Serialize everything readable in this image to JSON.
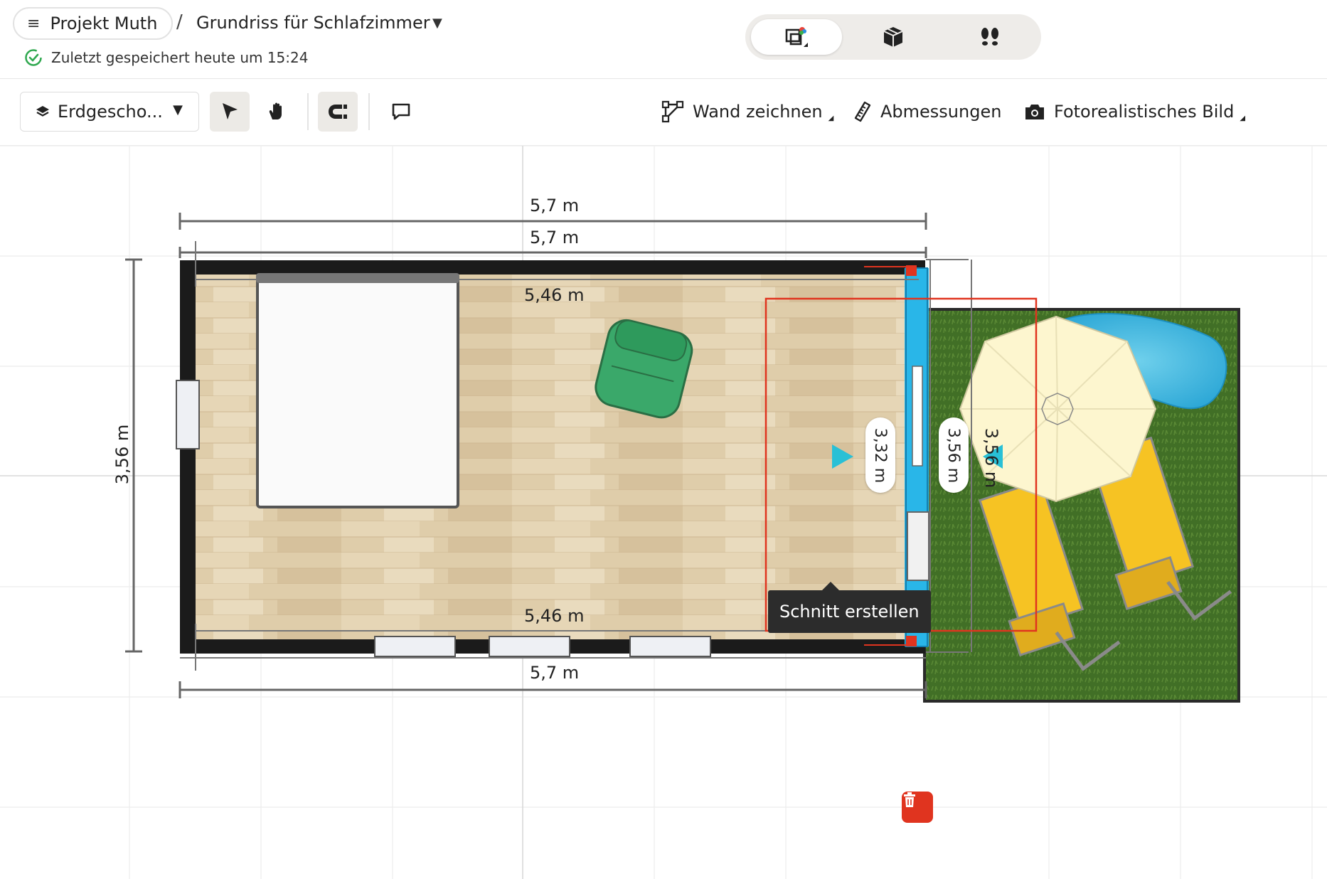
{
  "header": {
    "project_label": "Projekt Muth",
    "separator": "/",
    "plan_title": "Grundriss für Schlafzimmer",
    "saved_status": "Zuletzt gespeichert heute um 15:24"
  },
  "view_switch": {
    "active": "2d-view",
    "items": [
      "2d-view-icon",
      "3d-view-icon",
      "walkthrough-icon"
    ]
  },
  "toolbar": {
    "floor_label": "Erdgescho...",
    "actions": {
      "draw_wall": "Wand zeichnen",
      "dimensions": "Abmessungen",
      "photo": "Fotorealistisches Bild"
    }
  },
  "plan": {
    "outer_top": "5,7 m",
    "inner_top": "5,7 m",
    "room_top": "5,46 m",
    "room_bottom": "5,46 m",
    "outer_bottom": "5,7 m",
    "left_height": "3,56 m",
    "wall_inner": "3,32 m",
    "wall_outer": "3,56 m",
    "wall_far": "3,56 m"
  },
  "tooltip": "Schnitt erstellen",
  "colors": {
    "selection": "#e0341f",
    "wall_highlight": "#29b6e8",
    "cut_marker": "#29c0d6",
    "grass": "#3f6e26",
    "floor": "#dcc9a6",
    "wall": "#1b1b1b"
  }
}
